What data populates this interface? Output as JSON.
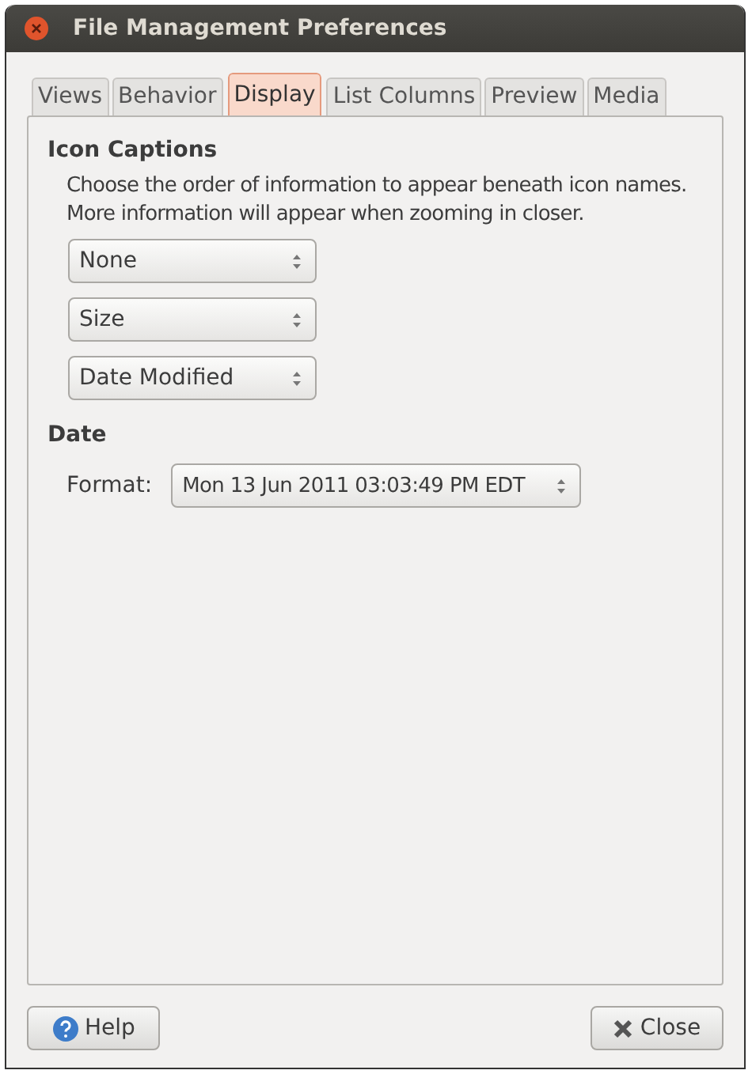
{
  "window": {
    "title": "File Management Preferences"
  },
  "tabs": [
    {
      "label": "Views",
      "selected": false
    },
    {
      "label": "Behavior",
      "selected": false
    },
    {
      "label": "Display",
      "selected": true
    },
    {
      "label": "List Columns",
      "selected": false
    },
    {
      "label": "Preview",
      "selected": false
    },
    {
      "label": "Media",
      "selected": false
    }
  ],
  "icon_captions": {
    "heading": "Icon Captions",
    "description": "Choose the order of information to appear beneath icon names. More information will appear when zooming in closer.",
    "selects": [
      "None",
      "Size",
      "Date Modified"
    ]
  },
  "date": {
    "heading": "Date",
    "format_label": "Format:",
    "format_value": "Mon 13 Jun 2011 03:03:49 PM EDT"
  },
  "buttons": {
    "help": "Help",
    "close": "Close"
  }
}
